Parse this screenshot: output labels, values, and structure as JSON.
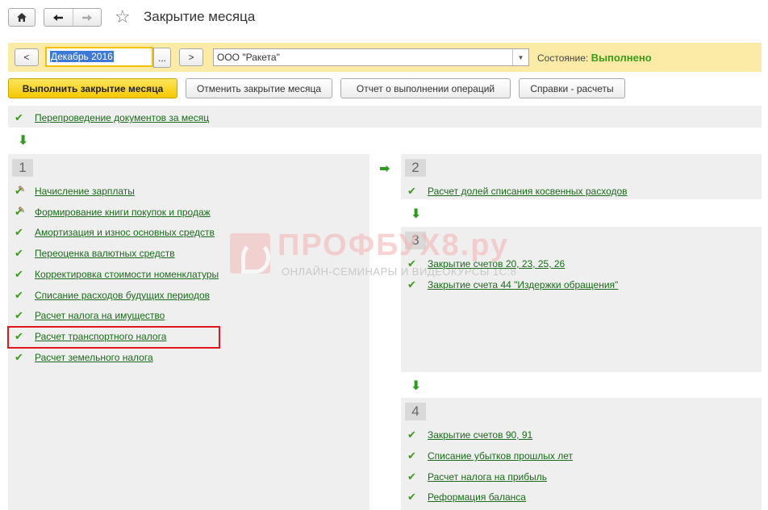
{
  "header": {
    "title": "Закрытие месяца",
    "home_icon": "home-icon",
    "back_icon": "arrow-left-icon",
    "forward_icon": "arrow-right-icon",
    "favorite_icon": "star-icon"
  },
  "period_bar": {
    "prev_label": "<",
    "next_label": ">",
    "period_value": "Декабрь 2016",
    "period_select_label": "...",
    "organization_value": "ООО \"Ракета\"",
    "status_label": "Состояние:",
    "status_value": "Выполнено"
  },
  "actions": {
    "run": "Выполнить закрытие месяца",
    "cancel": "Отменить закрытие месяца",
    "report": "Отчет о выполнении операций",
    "help": "Справки - расчеты"
  },
  "pre_step": {
    "label": "Перепроведение документов за месяц"
  },
  "steps": [
    {
      "number": "1",
      "items": [
        {
          "label": "Начисление зарплаты"
        },
        {
          "label": "Формирование книги покупок и продаж"
        },
        {
          "label": "Амортизация и износ основных средств"
        },
        {
          "label": "Переоценка валютных средств"
        },
        {
          "label": "Корректировка стоимости номенклатуры"
        },
        {
          "label": "Списание расходов будущих периодов"
        },
        {
          "label": "Расчет налога на имущество"
        },
        {
          "label": "Расчет транспортного налога"
        },
        {
          "label": "Расчет земельного налога"
        }
      ]
    },
    {
      "number": "2",
      "items": [
        {
          "label": "Расчет долей списания косвенных расходов"
        }
      ]
    },
    {
      "number": "3",
      "items": [
        {
          "label": "Закрытие счетов 20, 23, 25, 26"
        },
        {
          "label": "Закрытие счета 44 \"Издержки обращения\""
        }
      ]
    },
    {
      "number": "4",
      "items": [
        {
          "label": "Закрытие счетов 90, 91"
        },
        {
          "label": "Списание убытков прошлых лет"
        },
        {
          "label": "Расчет налога на прибыль"
        },
        {
          "label": "Реформация баланса"
        }
      ]
    }
  ],
  "watermark": {
    "title": "ПРОФБУХ8.ру",
    "subtitle": "ОНЛАЙН-СЕМИНАРЫ И ВИДЕОКУРСЫ 1С:8"
  },
  "colors": {
    "accent_yellow": "#f5c800",
    "period_bar": "#fbeba6",
    "link_green": "#1a6b1a",
    "check_green": "#3c9b1a",
    "highlight_red": "#e0161b"
  }
}
